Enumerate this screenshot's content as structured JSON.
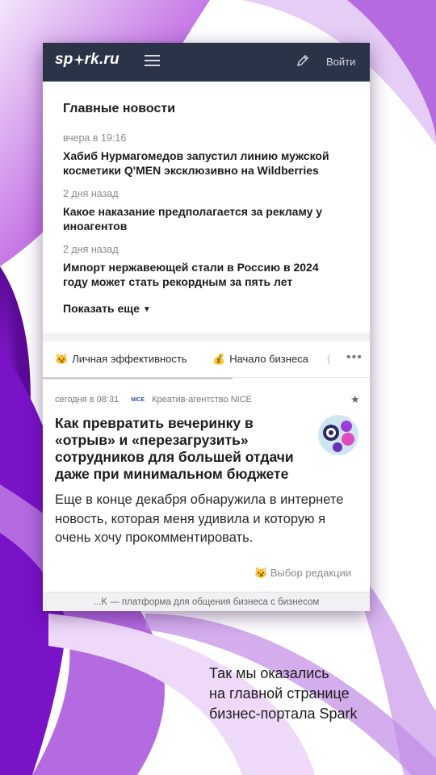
{
  "header": {
    "logo_prefix": "sp",
    "logo_suffix": "rk.ru",
    "login_label": "Войти"
  },
  "news": {
    "title": "Главные новости",
    "items": [
      {
        "time": "вчера в 19:16",
        "headline": "Хабиб Нурмагомедов запустил линию мужской косметики Q'MEN эксклюзивно на Wildberries"
      },
      {
        "time": "2 дня назад",
        "headline": "Какое наказание предполагается за рекламу у иноагентов"
      },
      {
        "time": "2 дня назад",
        "headline": "Импорт нержавеющей стали в Россию в 2024 году может стать рекордным за пять лет"
      }
    ],
    "show_more": "Показать еще"
  },
  "tabs": [
    {
      "emoji": "😼",
      "label": "Личная эффективность"
    },
    {
      "emoji": "💰",
      "label": "Начало бизнеса"
    }
  ],
  "card": {
    "time": "сегодня в 08:31",
    "source_logo": "NICE",
    "source": "Креатив-агентство NICE",
    "title": "Как превратить вечеринку в «отрыв» и «перезагрузить» сотрудников для большей отдачи даже при минимальном бюджете",
    "text": "Еще в конце декабря обнаружила в интернете новость, которая меня удивила и которую я очень хочу прокомментировать.",
    "editor_emoji": "😼",
    "editor_label": "Выбор редакции"
  },
  "footer": "...K — платформа для общения бизнеса с бизнесом",
  "caption": [
    "Так мы оказались",
    "на главной странице",
    "бизнес-портала Spark"
  ],
  "colors": {
    "topbar": "#2b3348",
    "accent_purple": "#8a2be2"
  }
}
